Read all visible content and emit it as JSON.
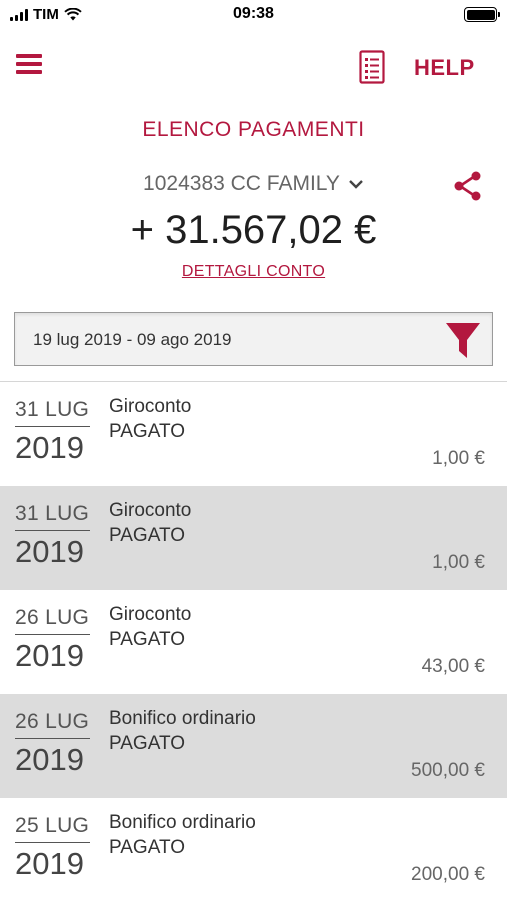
{
  "status_bar": {
    "carrier": "TIM",
    "time": "09:38"
  },
  "header": {
    "help_label": "HELP"
  },
  "page": {
    "title": "ELENCO PAGAMENTI",
    "account": "1024383 CC FAMILY",
    "balance": "+ 31.567,02 €",
    "details_link": "DETTAGLI CONTO"
  },
  "filter": {
    "date_range": "19 lug 2019 - 09 ago 2019"
  },
  "payments": [
    {
      "day": "31 LUG",
      "year": "2019",
      "type": "Giroconto",
      "status": "PAGATO",
      "amount": "1,00 €"
    },
    {
      "day": "31 LUG",
      "year": "2019",
      "type": "Giroconto",
      "status": "PAGATO",
      "amount": "1,00 €"
    },
    {
      "day": "26 LUG",
      "year": "2019",
      "type": "Giroconto",
      "status": "PAGATO",
      "amount": "43,00 €"
    },
    {
      "day": "26 LUG",
      "year": "2019",
      "type": "Bonifico ordinario",
      "status": "PAGATO",
      "amount": "500,00 €"
    },
    {
      "day": "25 LUG",
      "year": "2019",
      "type": "Bonifico ordinario",
      "status": "PAGATO",
      "amount": "200,00 €"
    }
  ],
  "colors": {
    "brand": "#b3183f",
    "row_alt": "#dcdcdc"
  }
}
